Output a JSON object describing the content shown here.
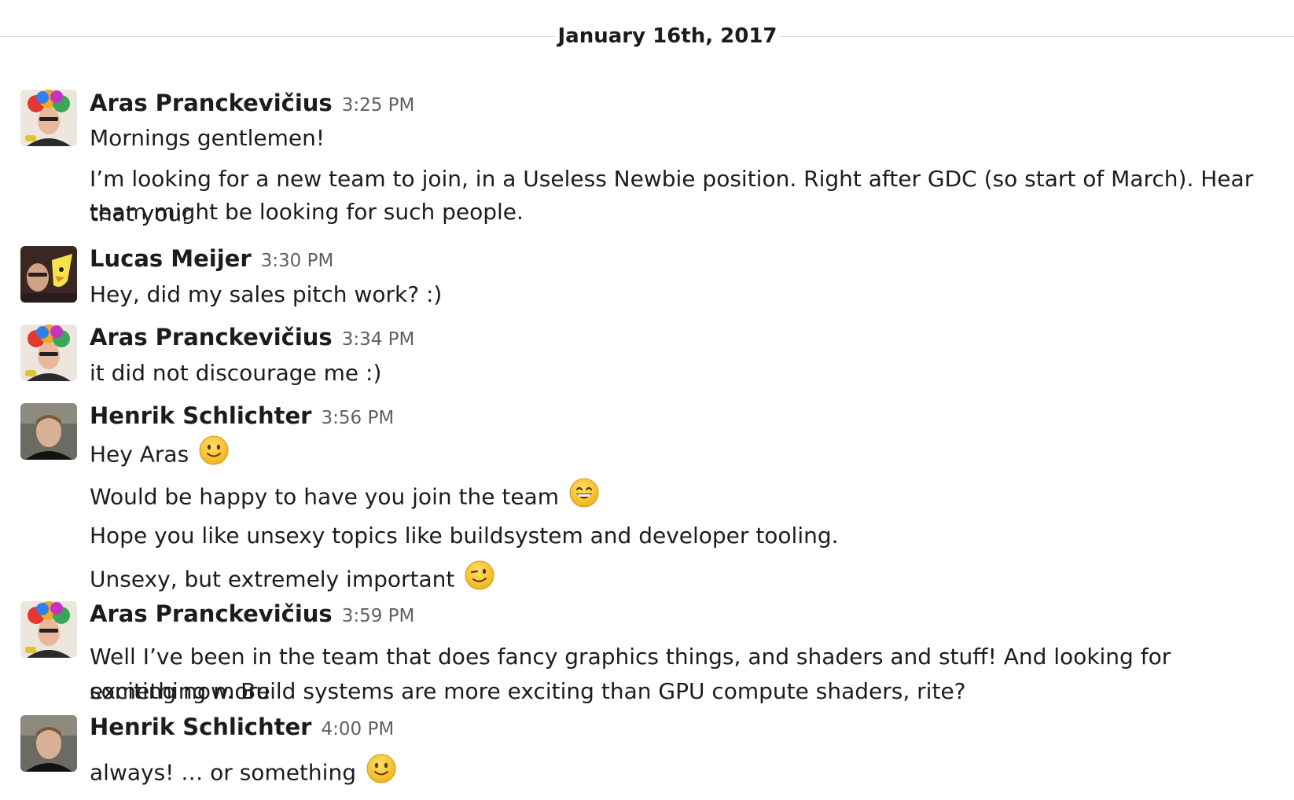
{
  "date_divider": "January 16th, 2017",
  "messages": [
    {
      "author": "Aras Pranckevičius",
      "time": "3:25 PM",
      "lines": [
        "Mornings gentlemen!",
        "I’m looking for a new team to join, in a Useless Newbie position. Right after GDC (so start of March). Hear that your",
        "team might be looking for such people."
      ]
    },
    {
      "author": "Lucas Meijer",
      "time": "3:30 PM",
      "lines": [
        "Hey, did my sales pitch work? :)"
      ]
    },
    {
      "author": "Aras Pranckevičius",
      "time": "3:34 PM",
      "lines": [
        "it did not discourage me :)"
      ]
    },
    {
      "author": "Henrik Schlichter",
      "time": "3:56 PM",
      "lines": [
        "Hey Aras",
        "Would be happy to have you join the team",
        "Hope you like unsexy topics like buildsystem and developer tooling.",
        "Unsexy, but extremely important"
      ]
    },
    {
      "author": "Aras Pranckevičius",
      "time": "3:59 PM",
      "lines": [
        "Well I’ve been in the team that does fancy graphics things, and shaders and stuff! And looking for something more",
        "exciting now. Build systems are more exciting than GPU compute shaders, rite?"
      ]
    },
    {
      "author": "Henrik Schlichter",
      "time": "4:00 PM",
      "lines": [
        "always! … or something"
      ]
    }
  ],
  "emojis": {
    "smile": "slightly-smiling-face-icon",
    "grin": "grinning-face-icon",
    "wink": "winking-face-icon"
  },
  "colors": {
    "text": "#1d1c1d",
    "time": "#616061",
    "divider": "#dddddd",
    "emoji": "#f7c52a"
  }
}
